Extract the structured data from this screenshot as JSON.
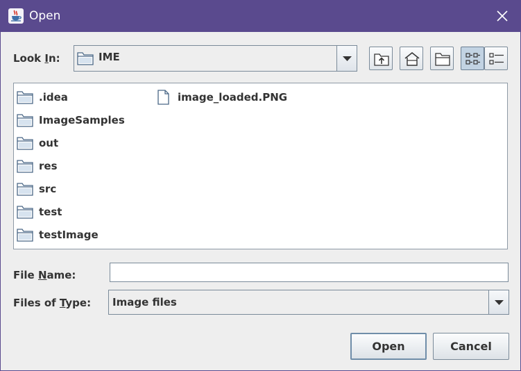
{
  "titlebar": {
    "title": "Open",
    "app_icon": "java-cup-icon",
    "close_icon": "close-icon"
  },
  "look_in": {
    "label_prefix": "Look ",
    "label_mnemonic": "I",
    "label_suffix": "n:",
    "selected": "IME"
  },
  "toolbar": {
    "icons": [
      "up-one-level-icon",
      "home-icon",
      "new-folder-icon",
      "list-view-icon",
      "details-view-icon"
    ],
    "active_view": "list"
  },
  "files": {
    "folders": [
      ".idea",
      "ImageSamples",
      "out",
      "res",
      "src",
      "test",
      "testImage"
    ],
    "documents": [
      "image_loaded.PNG"
    ]
  },
  "file_name": {
    "label_prefix": "File ",
    "label_mnemonic": "N",
    "label_suffix": "ame:",
    "value": ""
  },
  "file_type": {
    "label_prefix": "Files of ",
    "label_mnemonic": "T",
    "label_suffix": "ype:",
    "selected": "Image files"
  },
  "buttons": {
    "open": "Open",
    "cancel": "Cancel"
  },
  "colors": {
    "titlebar": "#5a4a8e",
    "dialog_background": "#eeeeee",
    "active_toggle": "#c2d3e3",
    "folder_icon": "#4a6786"
  }
}
